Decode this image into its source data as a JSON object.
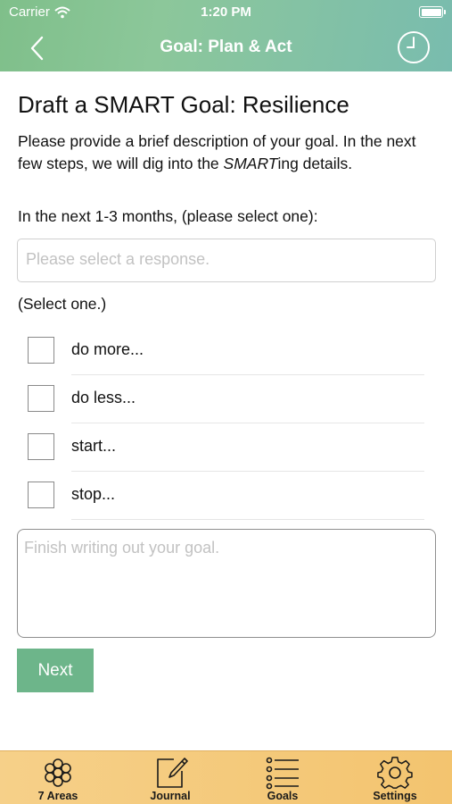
{
  "status_bar": {
    "carrier": "Carrier",
    "time": "1:20 PM"
  },
  "nav": {
    "title": "Goal: Plan & Act",
    "back_icon": "chevron-left-icon",
    "history_icon": "clock-icon"
  },
  "page": {
    "title": "Draft a SMART Goal: Resilience",
    "description_before": "Please provide a brief description of your goal. In the next few steps, we will dig into the ",
    "description_emphasis": "SMART",
    "description_after": "ing details.",
    "prompt": "In the next 1-3 months, (please select one):",
    "select_placeholder": "Please select a response.",
    "select_one_label": "(Select one.)",
    "options": [
      "do more...",
      "do less...",
      "start...",
      "stop..."
    ],
    "goal_placeholder": "Finish writing out your goal.",
    "next_label": "Next"
  },
  "tab_bar": {
    "tabs": [
      {
        "label": "7 Areas",
        "icon": "gear-flower-icon"
      },
      {
        "label": "Journal",
        "icon": "journal-edit-icon"
      },
      {
        "label": "Goals",
        "icon": "list-icon"
      },
      {
        "label": "Settings",
        "icon": "gear-icon"
      }
    ]
  },
  "colors": {
    "header_gradient_start": "#7fbf8a",
    "header_gradient_end": "#79bcae",
    "button_green": "#6db58a",
    "tab_bar_orange": "#f5c97a"
  }
}
